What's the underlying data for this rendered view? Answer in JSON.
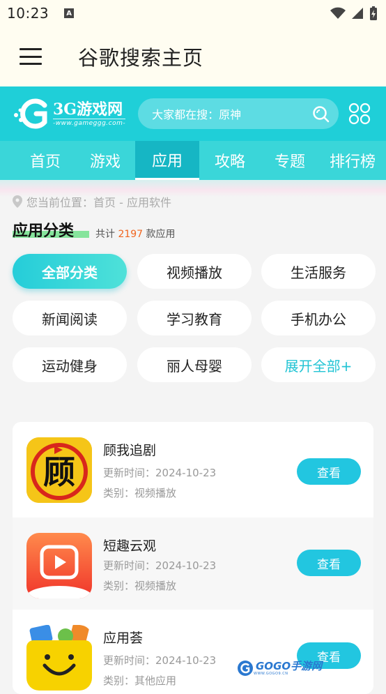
{
  "status": {
    "time": "10:23",
    "notification_glyph": "A"
  },
  "app_bar": {
    "title": "谷歌搜索主页"
  },
  "site": {
    "logo_name": "3G游戏网",
    "logo_url": "-www.gameggg.com-",
    "search_placeholder": "大家都在搜：原神"
  },
  "nav": {
    "items": [
      {
        "label": "首页"
      },
      {
        "label": "游戏"
      },
      {
        "label": "应用"
      },
      {
        "label": "攻略"
      },
      {
        "label": "专题"
      },
      {
        "label": "排行榜"
      }
    ],
    "active_index": 2
  },
  "breadcrumb": {
    "text": "您当前位置：首页 - 应用软件"
  },
  "section": {
    "title": "应用分类",
    "count_prefix": "共计",
    "count": "2197",
    "count_suffix": "款应用"
  },
  "categories": [
    {
      "label": "全部分类"
    },
    {
      "label": "视频播放"
    },
    {
      "label": "生活服务"
    },
    {
      "label": "新闻阅读"
    },
    {
      "label": "学习教育"
    },
    {
      "label": "手机办公"
    },
    {
      "label": "运动健身"
    },
    {
      "label": "丽人母婴"
    },
    {
      "label": "展开全部+"
    }
  ],
  "apps": [
    {
      "name": "顾我追剧",
      "updated": "更新时间：2024-10-23",
      "category": "类别：视频播放",
      "button": "查看",
      "icon_glyph": "顾",
      "icon": "guwo-app-icon"
    },
    {
      "name": "短趣云观",
      "updated": "更新时间：2024-10-23",
      "category": "类别：视频播放",
      "button": "查看",
      "icon": "play-video-app-icon"
    },
    {
      "name": "应用荟",
      "updated": "更新时间：2024-10-23",
      "category": "类别：其他应用",
      "button": "查看",
      "icon": "smile-bag-app-icon"
    }
  ],
  "watermark": {
    "text": "GOGO手游网",
    "sub": "WWW.GOGO9.CN"
  },
  "colors": {
    "accent": "#1fcfd8",
    "button": "#22c6e0",
    "count_highlight": "#f0651f"
  }
}
